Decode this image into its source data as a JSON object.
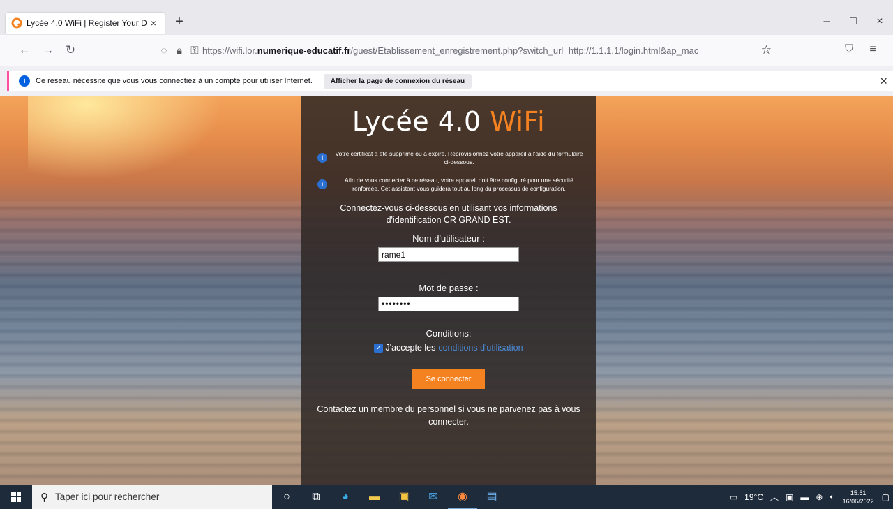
{
  "browser": {
    "tab_title": "Lycée 4.0 WiFi | Register Your D…",
    "tab_close": "×",
    "new_tab": "+",
    "window_minimize": "–",
    "window_restore": "□",
    "window_close": "×",
    "url_prefix": "https://wifi.lor.",
    "url_host": "numerique-educatif.fr",
    "url_path": "/guest/Etablissement_enregistrement.php?switch_url=http://1.1.1.1/login.html&ap_mac",
    "url_tail": "="
  },
  "notification": {
    "message": "Ce réseau nécessite que vous vous connectiez à un compte pour utiliser Internet.",
    "button_label": "Afficher la page de connexion du réseau",
    "close": "×"
  },
  "portal": {
    "title_main": "Lycée 4.0 ",
    "title_accent": "WiFi",
    "info_1": "Votre certificat a été supprimé ou a expiré. Reprovisionnez votre appareil à l'aide du formulaire ci-dessous.",
    "info_2": "Afin de vous connecter à ce réseau, votre appareil doit être configuré pour une sécurité renforcée. Cet assistant vous guidera tout au long du processus de configuration.",
    "lead": "Connectez-vous ci-dessous en utilisant vos informations d'identification CR GRAND EST.",
    "username_label": "Nom d'utilisateur :",
    "username_value": "rame1",
    "password_label": "Mot de passe :",
    "password_value": "••••••••",
    "conditions_title": "Conditions:",
    "accept_text": "J'accepte les",
    "conditions_link": "conditions d'utilisation",
    "submit_label": "Se connecter",
    "contact_text": "Contactez un membre du personnel si vous ne parvenez pas à vous connecter.",
    "accent_color": "#f58220"
  },
  "taskbar": {
    "search_placeholder": "Taper ici pour rechercher",
    "weather": "19°C",
    "time": "15:51",
    "date": "16/06/2022"
  }
}
